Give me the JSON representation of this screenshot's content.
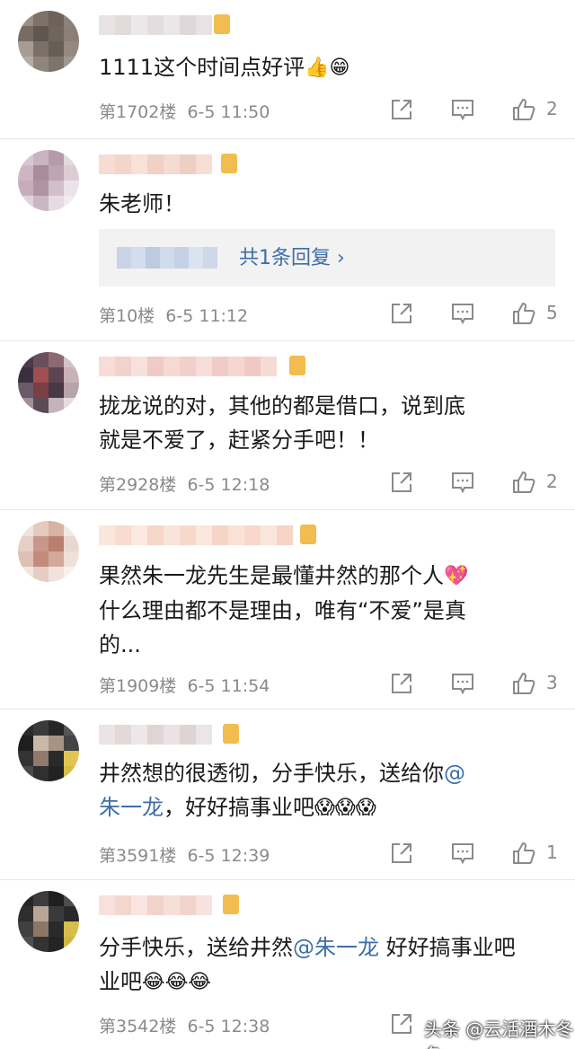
{
  "comments": [
    {
      "text": "1111这个时间点好评",
      "emojis": [
        "👍",
        "😁"
      ],
      "floor": "第1702楼",
      "time": "6-5 11:50",
      "likes": "2"
    },
    {
      "text": "朱老师！",
      "floor": "第10楼",
      "time": "6-5 11:12",
      "likes": "5",
      "reply_link": "共1条回复 ›"
    },
    {
      "line1": "拢龙说的对，其他的都是借口，说到底",
      "line2": "就是不爱了，赶紧分手吧！！",
      "floor": "第2928楼",
      "time": "6-5 12:18",
      "likes": "2"
    },
    {
      "line1": "果然朱一龙先生是最懂井然的那个人",
      "line1_emoji": "💖",
      "line2": "什么理由都不是理由，唯有“不爱”是真",
      "line3": "的...",
      "floor": "第1909楼",
      "time": "6-5 11:54",
      "likes": "3"
    },
    {
      "line1": "井然想的很透彻，分手快乐，送给你",
      "mention_a": "@",
      "mention_b": "朱一龙",
      "line2_rest": "，好好搞事业吧",
      "emojis": "😱😱😱",
      "floor": "第3591楼",
      "time": "6-5 12:39",
      "likes": "1"
    },
    {
      "line1_pre": "分手快乐，送给井然",
      "mention": "@朱一龙",
      "line1_post": " 好好搞事业吧",
      "line2": "业吧",
      "emojis": "😂😂😂",
      "floor": "第3542楼",
      "time": "6-5 12:38"
    }
  ],
  "watermark": "头条 @云活酒木冬冬",
  "icons": {
    "share": "share-icon",
    "comment": "comment-icon",
    "like": "thumbs-up-icon"
  }
}
